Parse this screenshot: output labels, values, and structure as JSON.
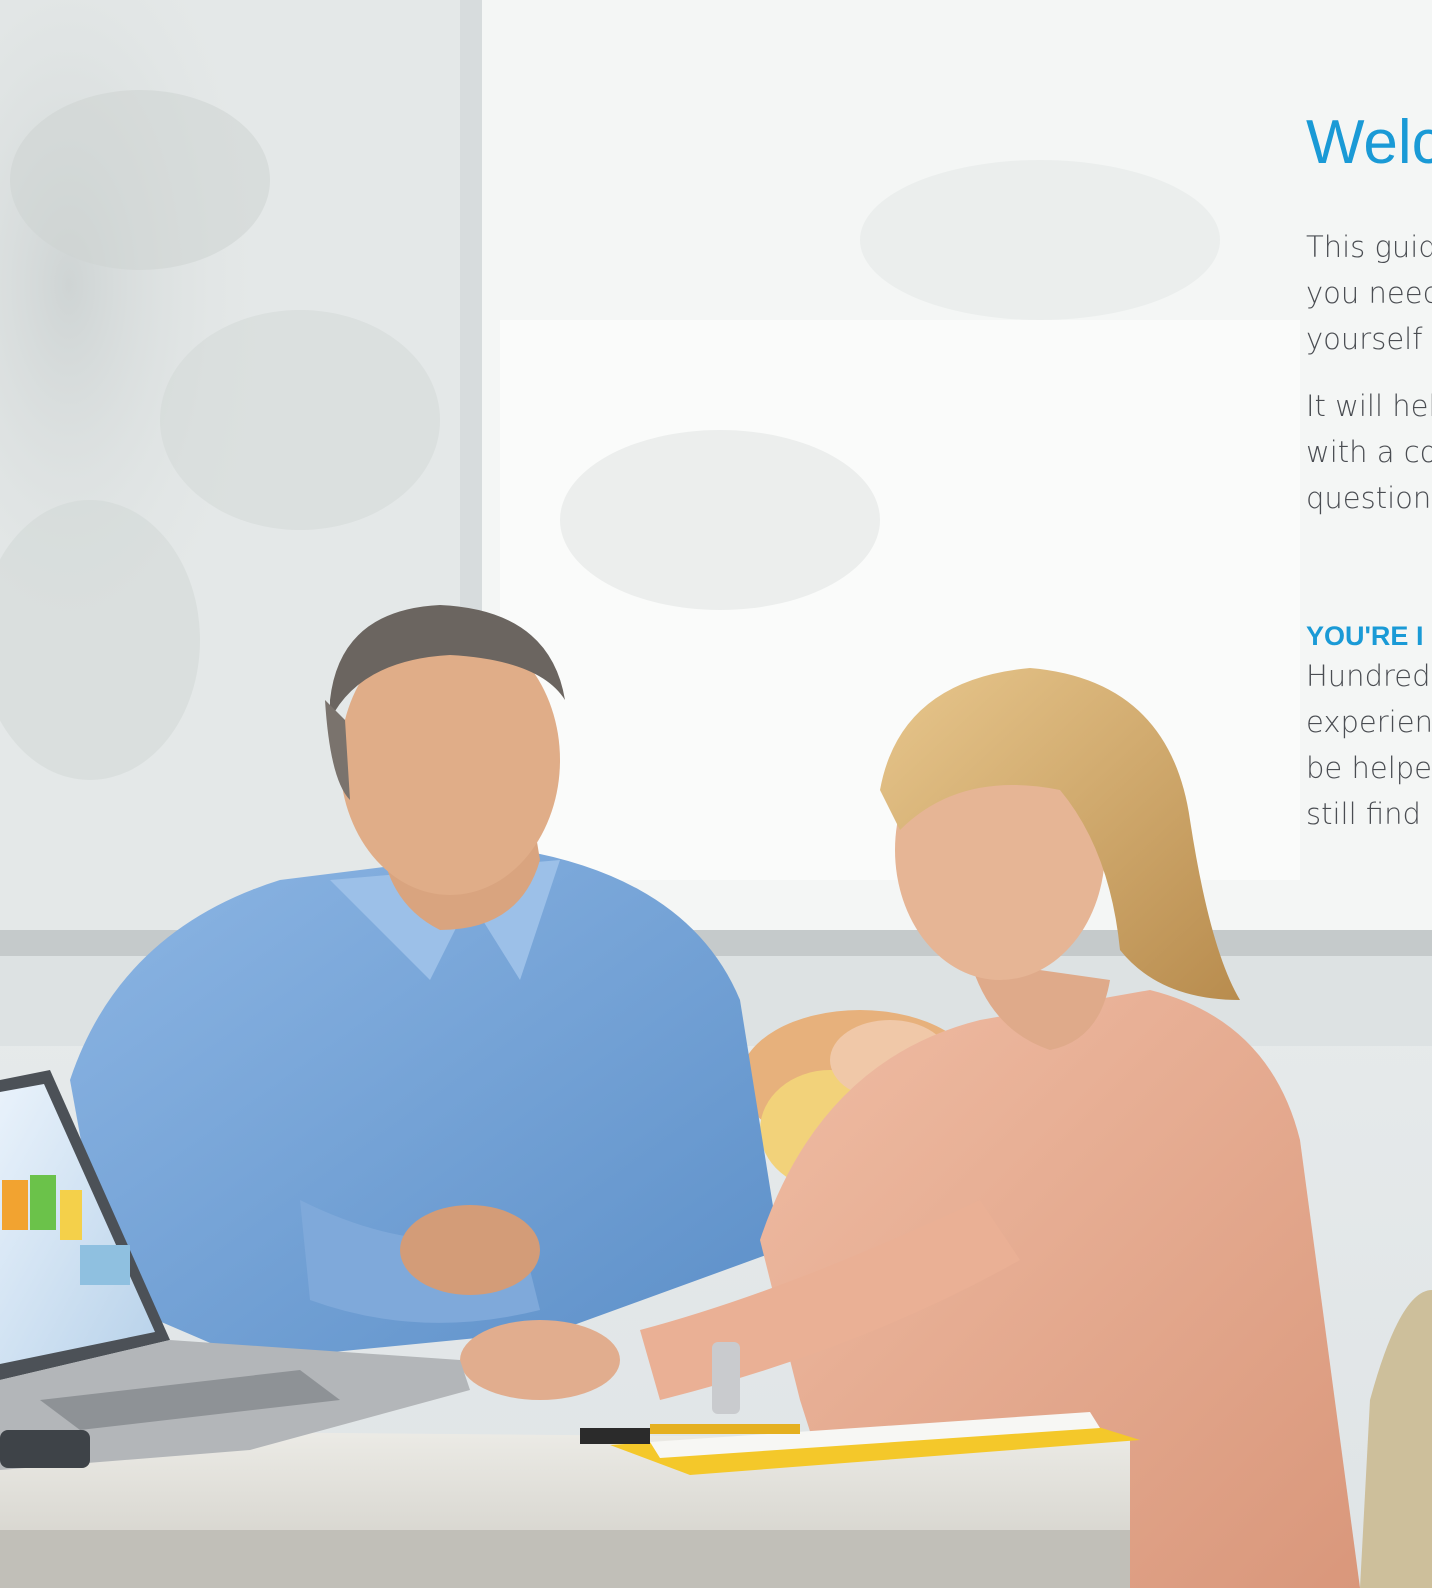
{
  "heading": "Welc",
  "paragraph1": [
    "This guid",
    "you need",
    "yourself"
  ],
  "paragraph2": [
    "It will hel",
    "with a co",
    "question"
  ],
  "subheading": "YOU'RE I",
  "paragraph3": [
    "Hundred",
    "experien",
    "be helpe",
    "still find"
  ],
  "photo": {
    "description_icon": "people-at-desk-photo",
    "colors": {
      "wall": "#e8eced",
      "window_blind": "#f3f5f4",
      "man_shirt": "#6fa2d8",
      "woman_blouse": "#e8ad93",
      "desk": "#e4e3de",
      "laptop": "#a9acaf",
      "notepad": "#f4c82a"
    }
  }
}
